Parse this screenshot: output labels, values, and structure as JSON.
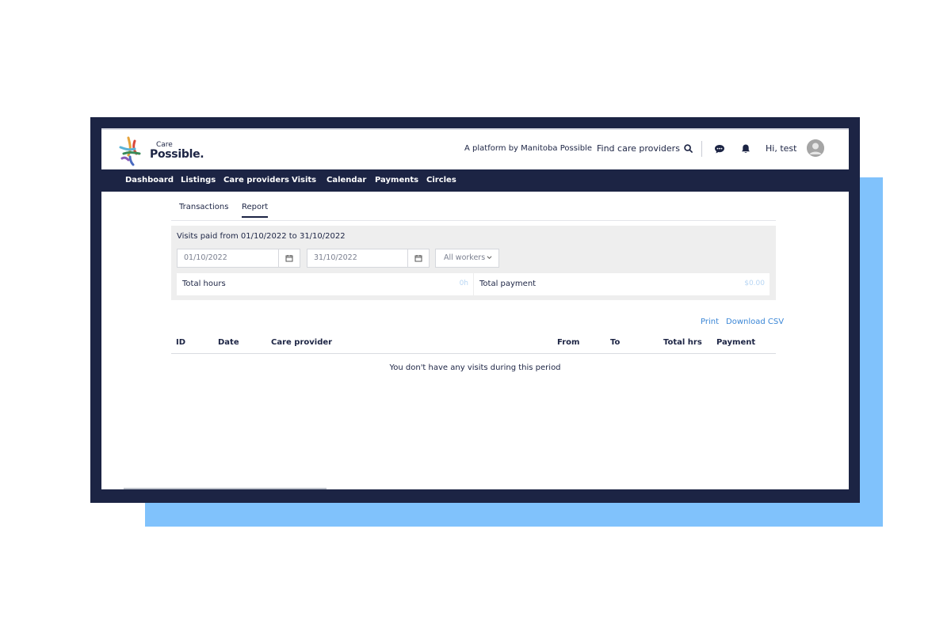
{
  "header": {
    "logo_small": "Care",
    "logo_big": "Possible.",
    "platform_text": "A platform by Manitoba Possible",
    "find_label": "Find care providers",
    "greeting": "Hi, test"
  },
  "nav": {
    "items": [
      "Dashboard",
      "Listings",
      "Care providers",
      "Visits",
      "Calendar",
      "Payments",
      "Circles"
    ]
  },
  "tabs": {
    "transactions": "Transactions",
    "report": "Report",
    "active": "Report"
  },
  "filter": {
    "period_text": "Visits paid from 01/10/2022 to 31/10/2022",
    "from_date": "01/10/2022",
    "to_date": "31/10/2022",
    "worker_select": "All workers",
    "total_hours_label": "Total hours",
    "total_hours_value": "0h",
    "total_payment_label": "Total payment",
    "total_payment_value": "$0.00"
  },
  "actions": {
    "print": "Print",
    "download_csv": "Download CSV"
  },
  "table": {
    "columns": [
      "ID",
      "Date",
      "Care provider",
      "From",
      "To",
      "Total hrs",
      "Payment"
    ],
    "empty_message": "You don't have any visits during this period"
  },
  "colors": {
    "navy": "#1c2444",
    "accent_blue": "#80c2fc",
    "link_blue": "#3a86d6"
  }
}
